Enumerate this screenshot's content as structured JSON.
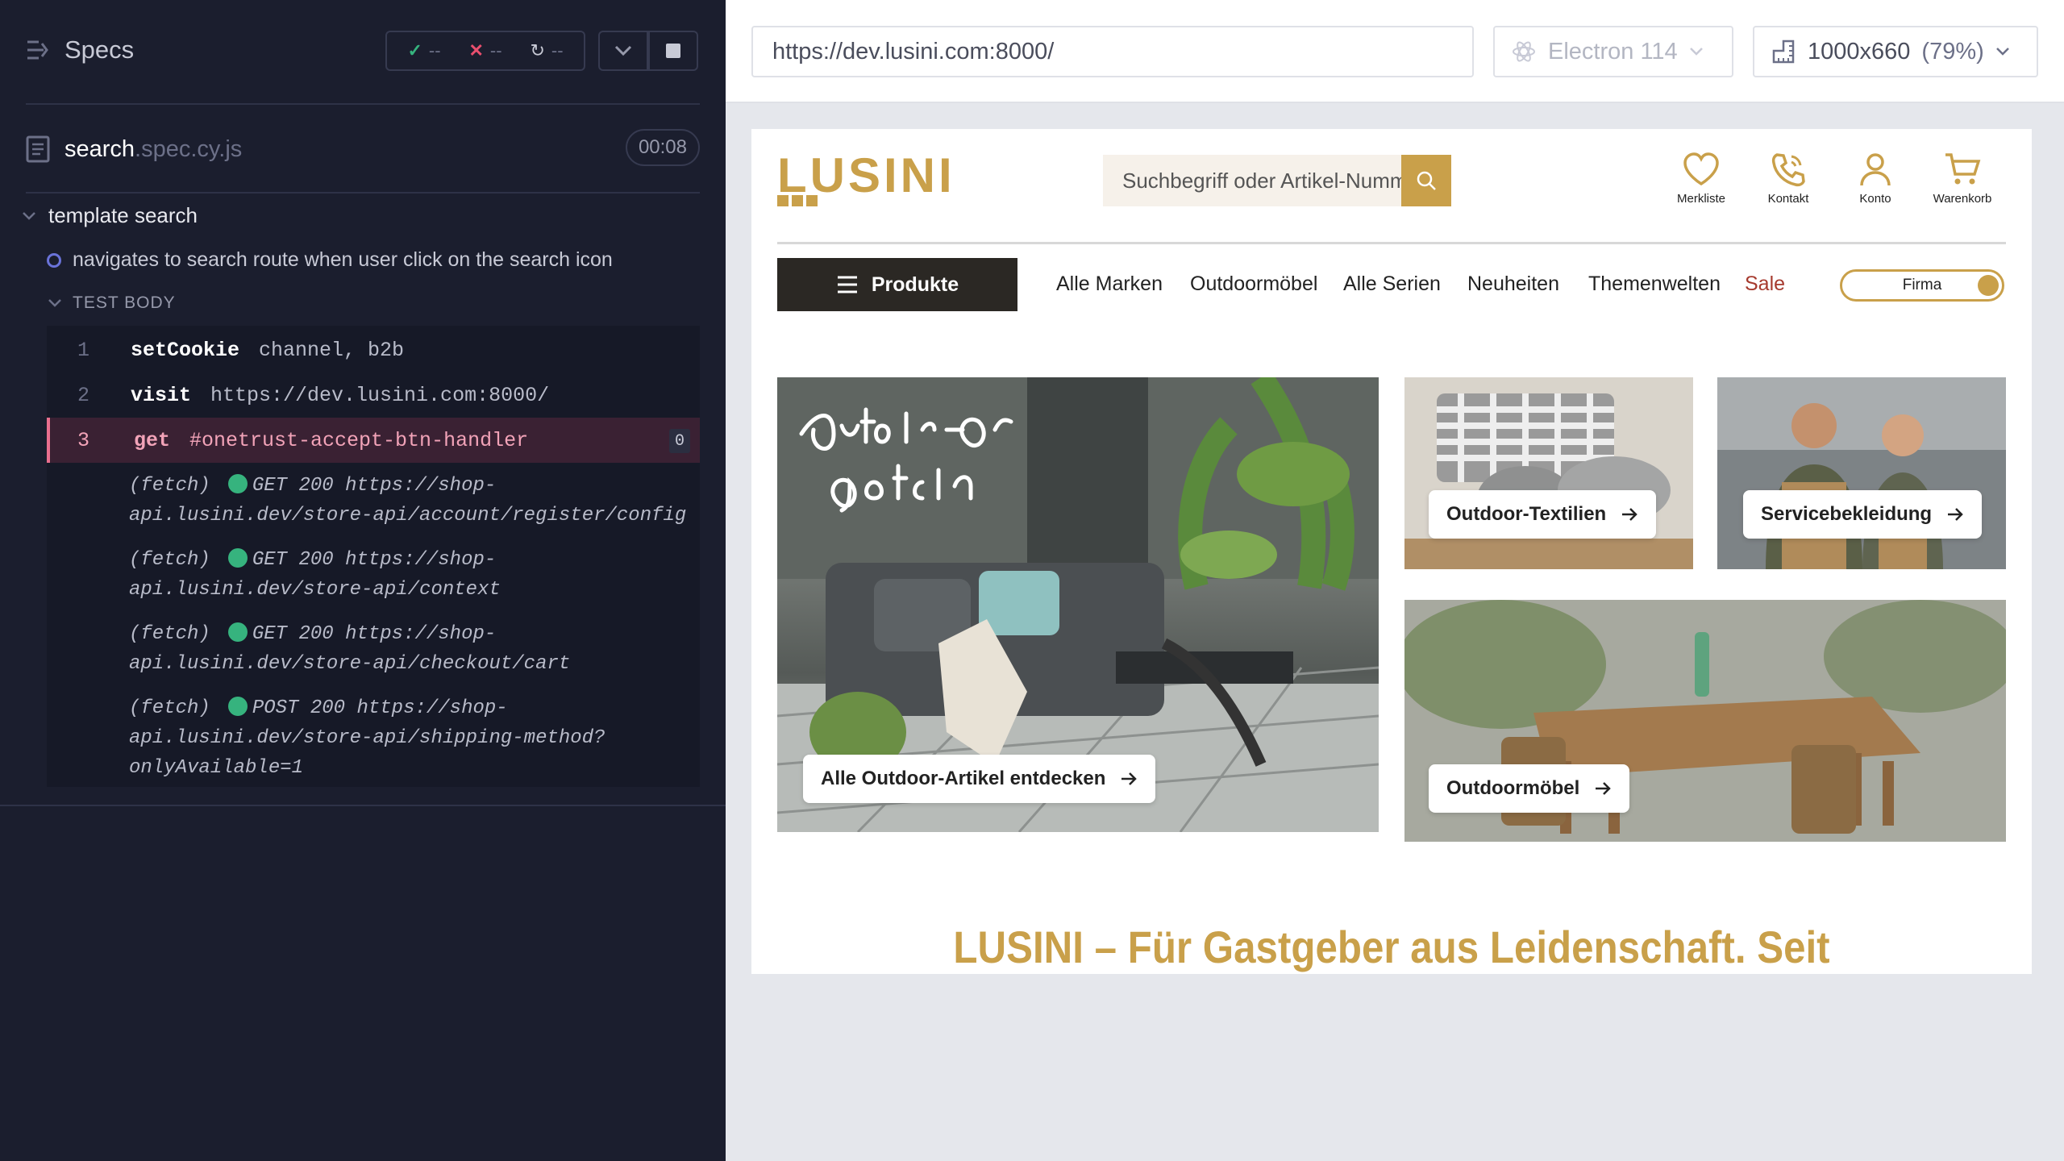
{
  "reporter": {
    "specs_label": "Specs",
    "stats": {
      "passed": "--",
      "failed": "--",
      "pending": "--"
    },
    "file": {
      "name": "search",
      "ext": ".spec.cy.js",
      "duration": "00:08"
    },
    "suite_title": "template search",
    "test_title": "navigates to search route when user click on the search icon",
    "test_body_label": "TEST BODY",
    "commands": [
      {
        "num": "1",
        "name": "setCookie",
        "message": "channel, b2b"
      },
      {
        "num": "2",
        "name": "visit",
        "message": "https://dev.lusini.com:8000/"
      },
      {
        "num": "3",
        "name": "get",
        "message": "#onetrust-accept-btn-handler",
        "badge": "0"
      }
    ],
    "fetches": [
      {
        "prefix": "(fetch)",
        "method": "GET 200",
        "line1": "https://shop-",
        "line2": "api.lusini.dev/store-api/account/register/config",
        "line3": ""
      },
      {
        "prefix": "(fetch)",
        "method": "GET 200",
        "line1": "https://shop-",
        "line2": "api.lusini.dev/store-api/context",
        "line3": ""
      },
      {
        "prefix": "(fetch)",
        "method": "GET 200",
        "line1": "https://shop-",
        "line2": "api.lusini.dev/store-api/checkout/cart",
        "line3": ""
      },
      {
        "prefix": "(fetch)",
        "method": "POST 200",
        "line1": "https://shop-",
        "line2": "api.lusini.dev/store-api/shipping-method?",
        "line3": "onlyAvailable=1"
      }
    ]
  },
  "browser": {
    "url": "https://dev.lusini.com:8000/",
    "browser_name": "Electron 114",
    "viewport_size": "1000x660",
    "zoom": "(79%)"
  },
  "site": {
    "logo_text": "LUSINI",
    "search_placeholder": "Suchbegriff oder Artikel-Nummer ein",
    "header_icons": [
      "Merkliste",
      "Kontakt",
      "Konto",
      "Warenkorb"
    ],
    "products_button": "Produkte",
    "nav": [
      "Alle Marken",
      "Outdoormöbel",
      "Alle Serien",
      "Neuheiten",
      "Themenwelten",
      "Sale"
    ],
    "toggle_label": "Firma",
    "tiles": {
      "main_overlay": "Outdoor-Oasen gestalten",
      "main_cta": "Alle Outdoor-Artikel entdecken",
      "textiles": "Outdoor-Textilien",
      "service": "Servicebekleidung",
      "furniture": "Outdoormöbel"
    },
    "headline": "LUSINI – Für Gastgeber aus Leidenschaft. Seit"
  },
  "colors": {
    "accent": "#c9a04a",
    "reporter_bg": "#1b1e2e",
    "active_cmd": "#e96f8e",
    "sale": "#a63a2e"
  }
}
